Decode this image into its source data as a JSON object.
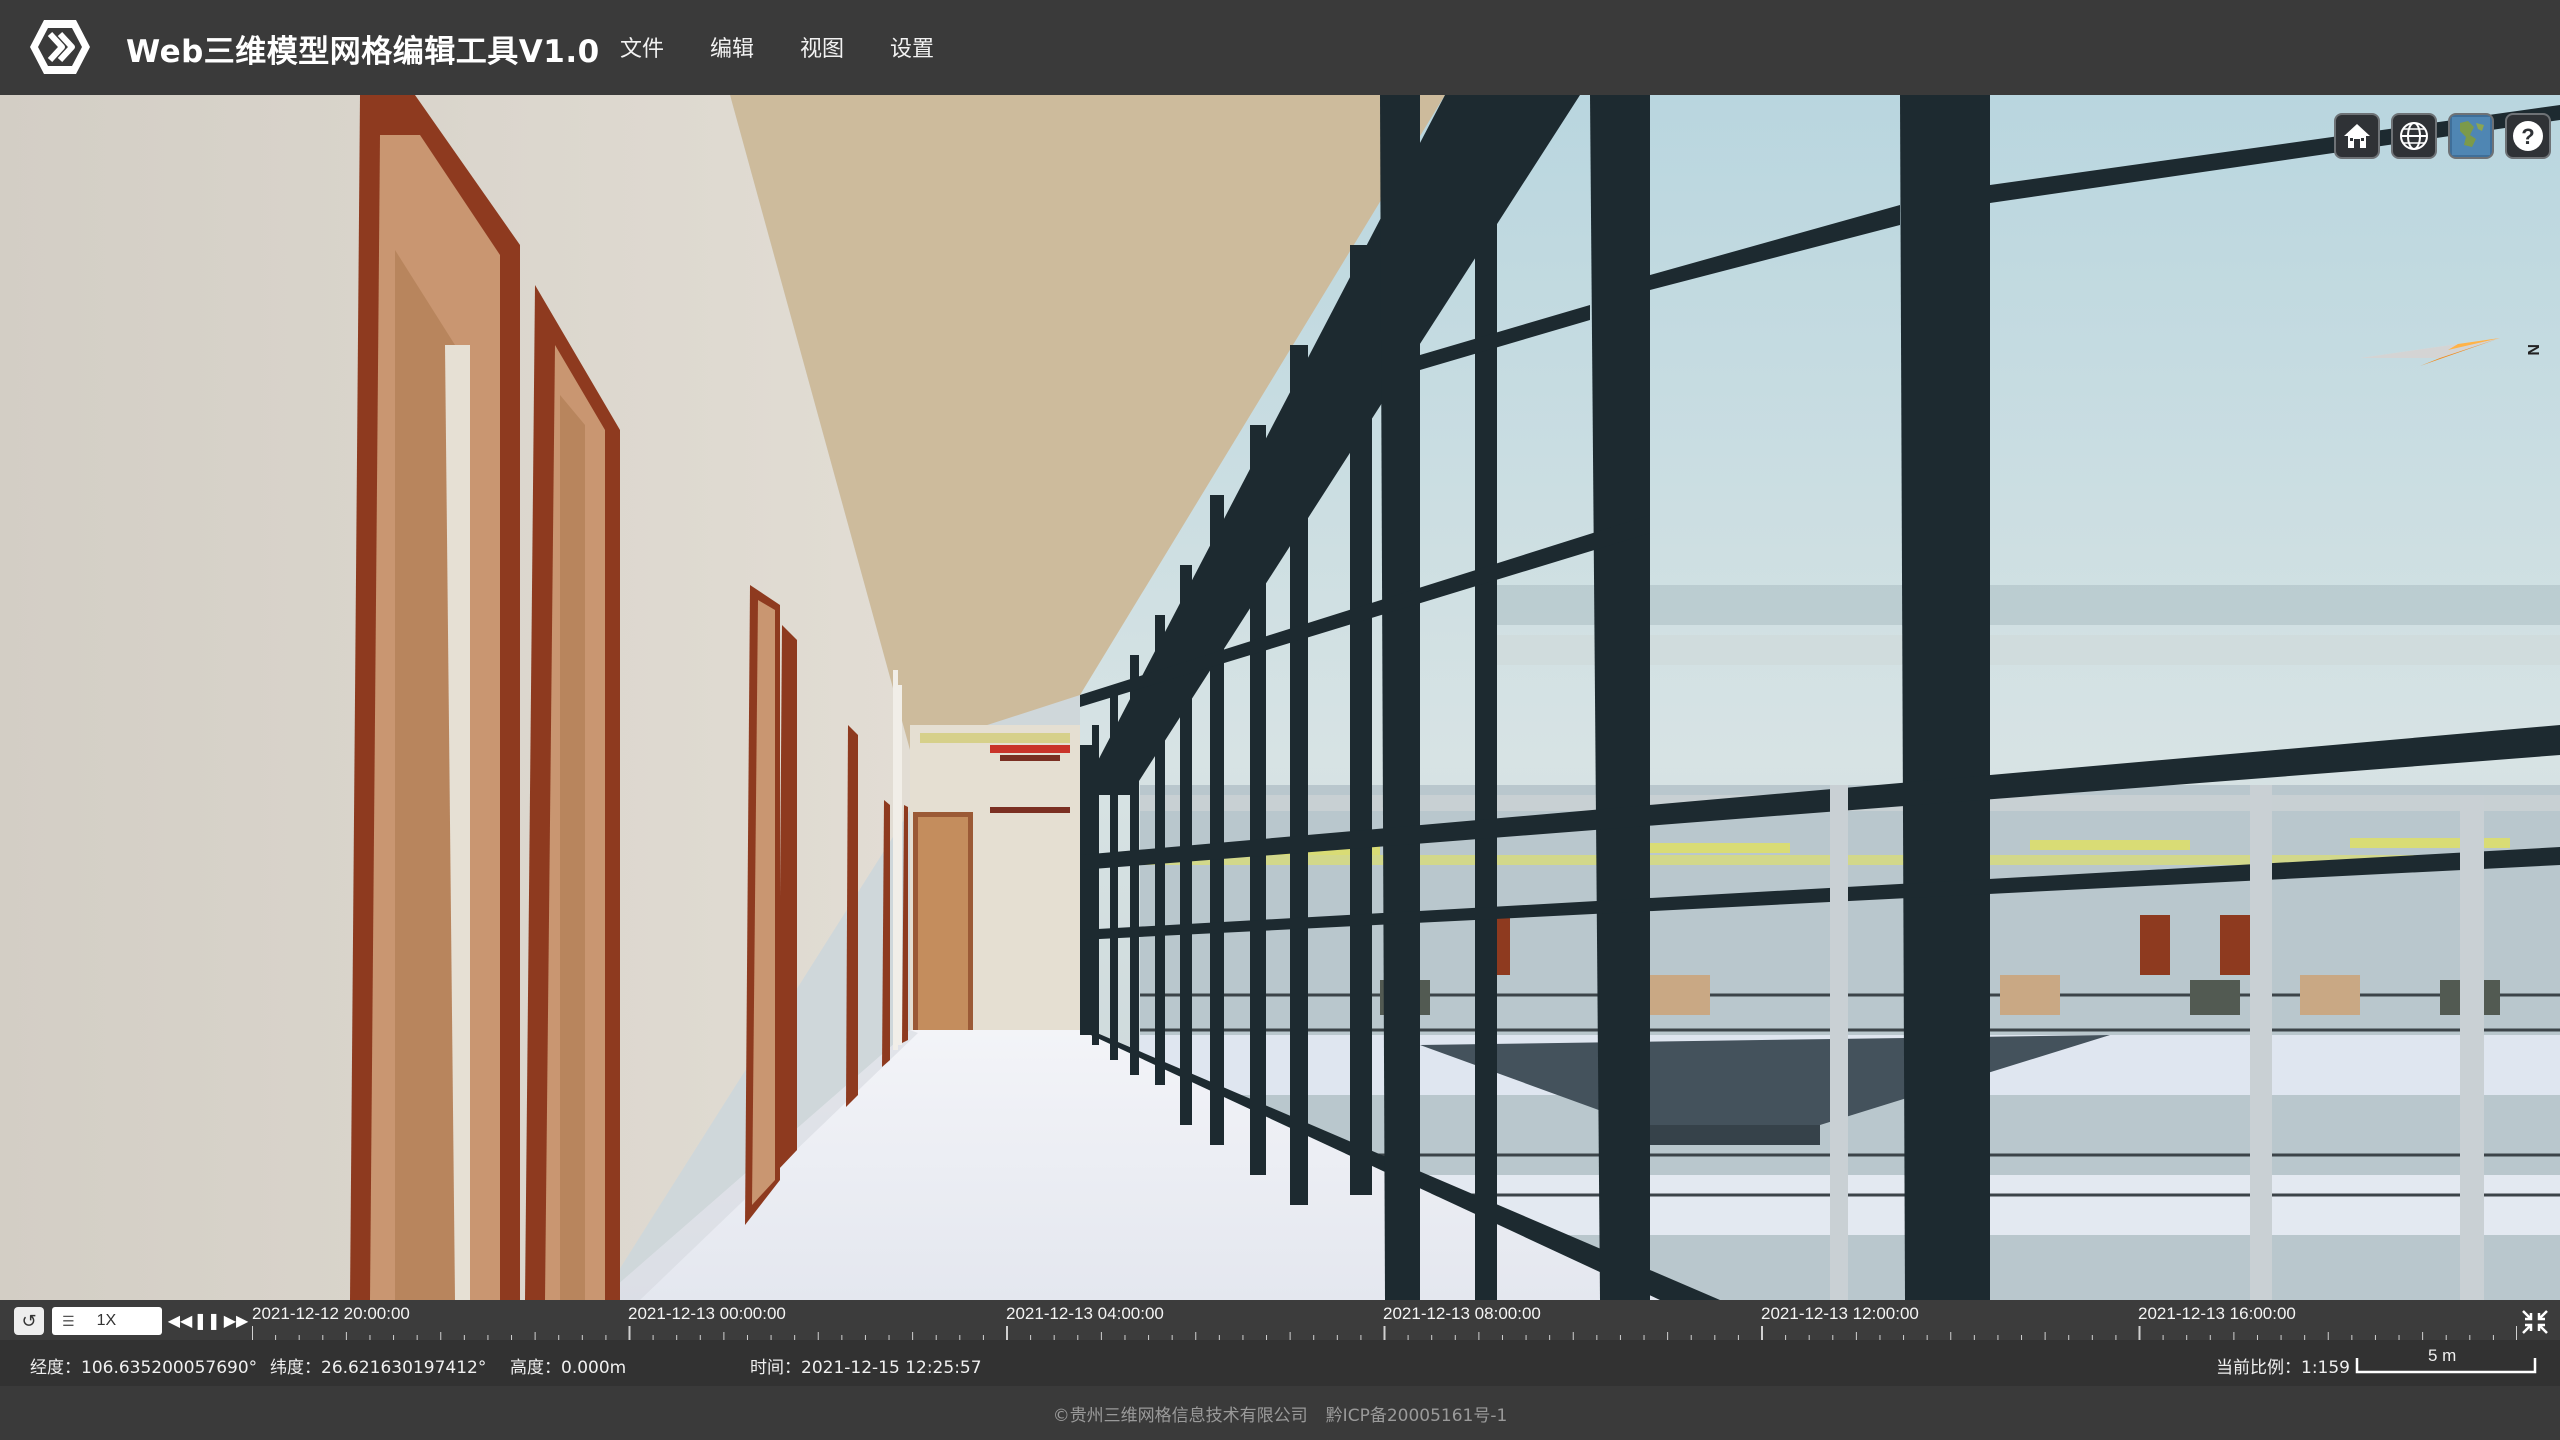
{
  "header": {
    "title": "Web三维模型网格编辑工具V1.0",
    "menu": [
      "文件",
      "编辑",
      "视图",
      "设置"
    ]
  },
  "toolbar": {
    "icons": [
      "home-icon",
      "globe-icon",
      "layer-icon",
      "help-icon"
    ],
    "help_label": "?"
  },
  "compass": {
    "label": "N"
  },
  "timeline": {
    "speed": "1X",
    "labels": [
      "2021-12-12 20:00:00",
      "2021-12-13 00:00:00",
      "2021-12-13 04:00:00",
      "2021-12-13 08:00:00",
      "2021-12-13 12:00:00",
      "2021-12-13 16:00:00"
    ]
  },
  "status": {
    "longitude": "经度：106.635200057690°",
    "latitude": "纬度：26.621630197412°",
    "altitude": "高度：0.000m",
    "time": "时间：2021-12-15 12:25:57",
    "scale_ratio": "当前比例：1:159",
    "scale_bar": "5 m"
  },
  "footer": {
    "copyright": "©贵州三维网格信息技术有限公司",
    "icp": "黔ICP备20005161号-1"
  },
  "colors": {
    "header_bg": "#3a3a3a",
    "wall": "#d9d4cb",
    "ceiling": "#cdbb9c",
    "floor": "#eceff6",
    "door_frame": "#8e3a1f",
    "window_frame": "#1d2a30",
    "sky": "#c9dde2"
  }
}
